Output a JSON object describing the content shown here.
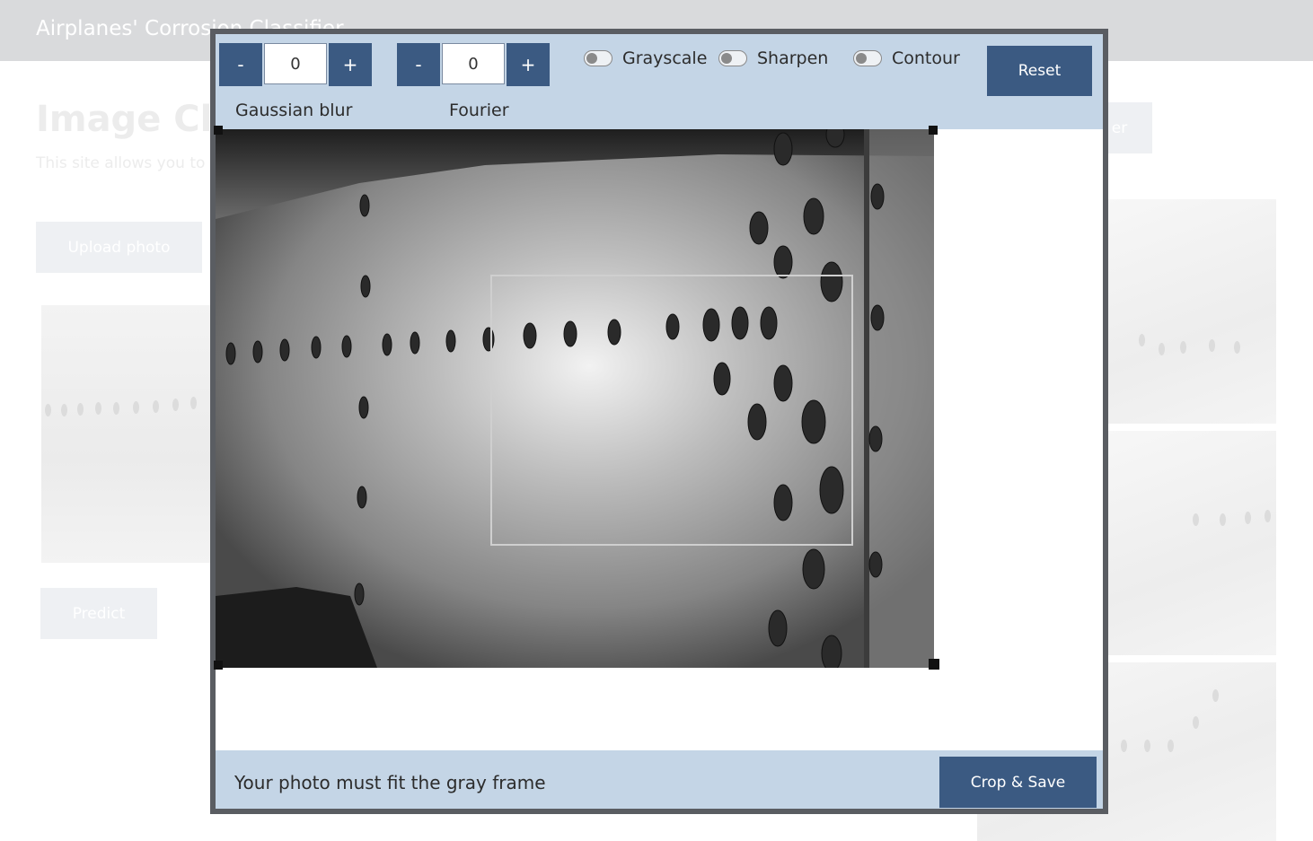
{
  "app": {
    "title": "Airplanes' Corrosion Classifier"
  },
  "background": {
    "heading": "Image Clas",
    "subtitle": "This site allows you to",
    "upload_label": "Upload photo",
    "predict_label": "Predict",
    "other_label": "er"
  },
  "editor": {
    "gaussian": {
      "label": "Gaussian blur",
      "value": "0",
      "minus": "-",
      "plus": "+"
    },
    "fourier": {
      "label": "Fourier",
      "value": "0",
      "minus": "-",
      "plus": "+"
    },
    "toggles": [
      {
        "label": "Grayscale",
        "on": false
      },
      {
        "label": "Sharpen",
        "on": false
      },
      {
        "label": "Contour",
        "on": false
      }
    ],
    "reset_label": "Reset",
    "footer_message": "Your photo must fit the gray frame",
    "crop_label": "Crop & Save"
  },
  "colors": {
    "accent": "#3b5a82",
    "toolbar_bg": "#c4d5e6",
    "modal_border": "#5a5d62",
    "crop_frame": "#cfcfcf"
  }
}
